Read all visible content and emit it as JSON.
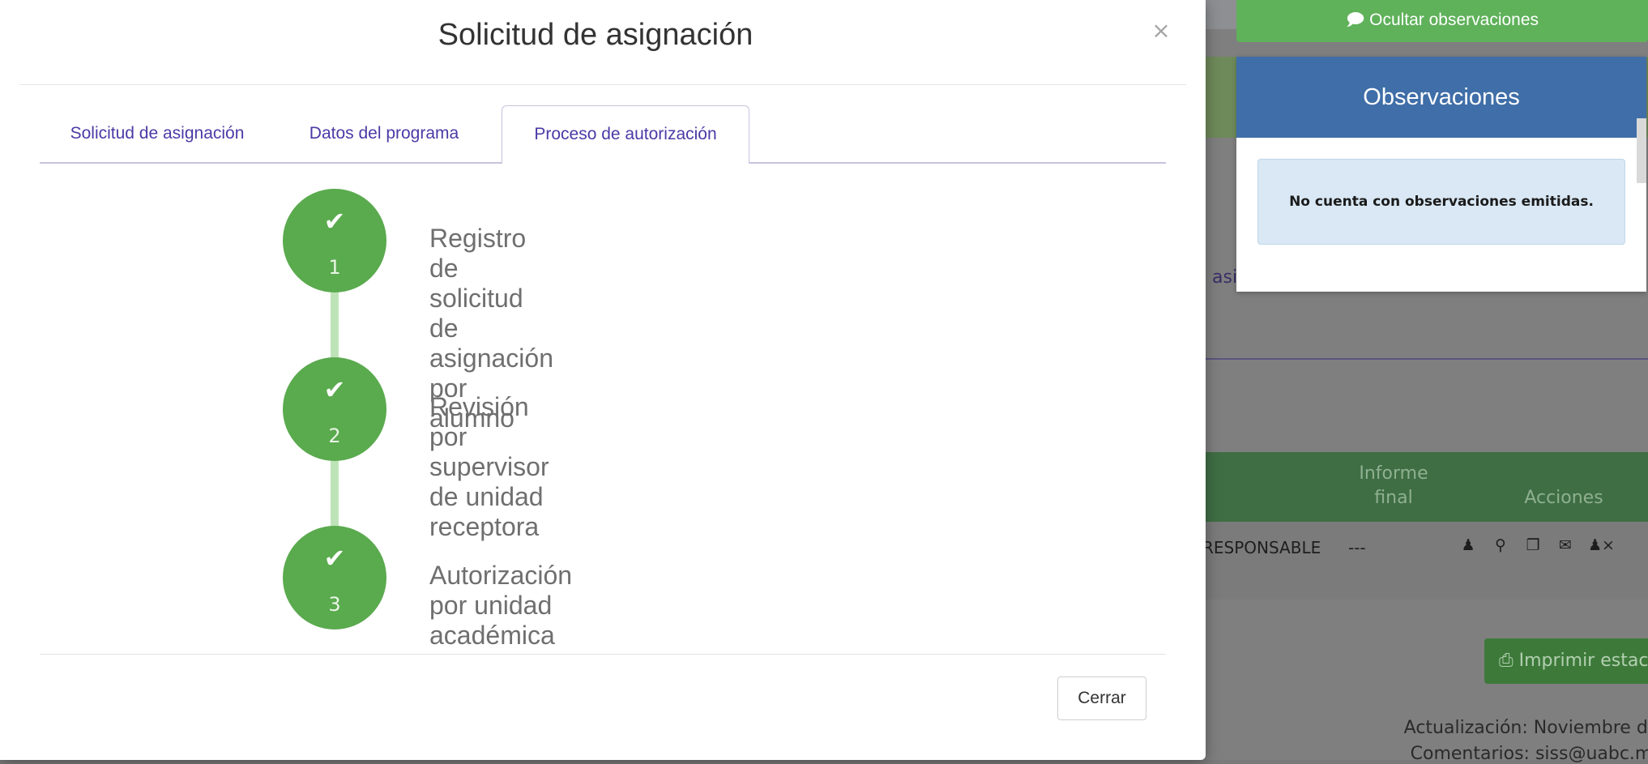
{
  "modal": {
    "title": "Solicitud de asignación",
    "close_glyph": "×",
    "tabs": [
      {
        "label": "Solicitud de asignación",
        "active": false
      },
      {
        "label": "Datos del programa",
        "active": false
      },
      {
        "label": "Proceso de autorización",
        "active": true
      }
    ],
    "steps": [
      {
        "number": "1",
        "label": "Registro de solicitud de asignación por alumno",
        "status": "complete"
      },
      {
        "number": "2",
        "label": "Revisión por supervisor de unidad receptora",
        "status": "complete"
      },
      {
        "number": "3",
        "label": "Autorización por unidad académica",
        "status": "complete"
      }
    ],
    "check_glyph": "✔",
    "close_button": "Cerrar"
  },
  "observaciones": {
    "toggle_label": "Ocultar observaciones",
    "toggle_icon": "comments-icon",
    "header": "Observaciones",
    "message": "No cuenta con observaciones emitidas."
  },
  "background": {
    "fragment": "asi",
    "table_headers": [
      "Informe final",
      "Acciones"
    ],
    "row_cells": [
      "RESPONSABLE",
      "---"
    ],
    "action_icons": [
      "user-icon",
      "search-icon",
      "copy-icon",
      "comments-icon",
      "user-remove-icon"
    ],
    "print_button": "Imprimir estac",
    "footer_line1": "Actualización: Noviembre de",
    "footer_line2": "Comentarios: siss@uabc.m"
  },
  "colors": {
    "step_green": "#5aaa4e",
    "connector_green": "#bfe3b8",
    "tab_purple": "#4b3aa6",
    "panel_blue": "#3f6ea8",
    "toggle_green": "#5fb15a"
  }
}
